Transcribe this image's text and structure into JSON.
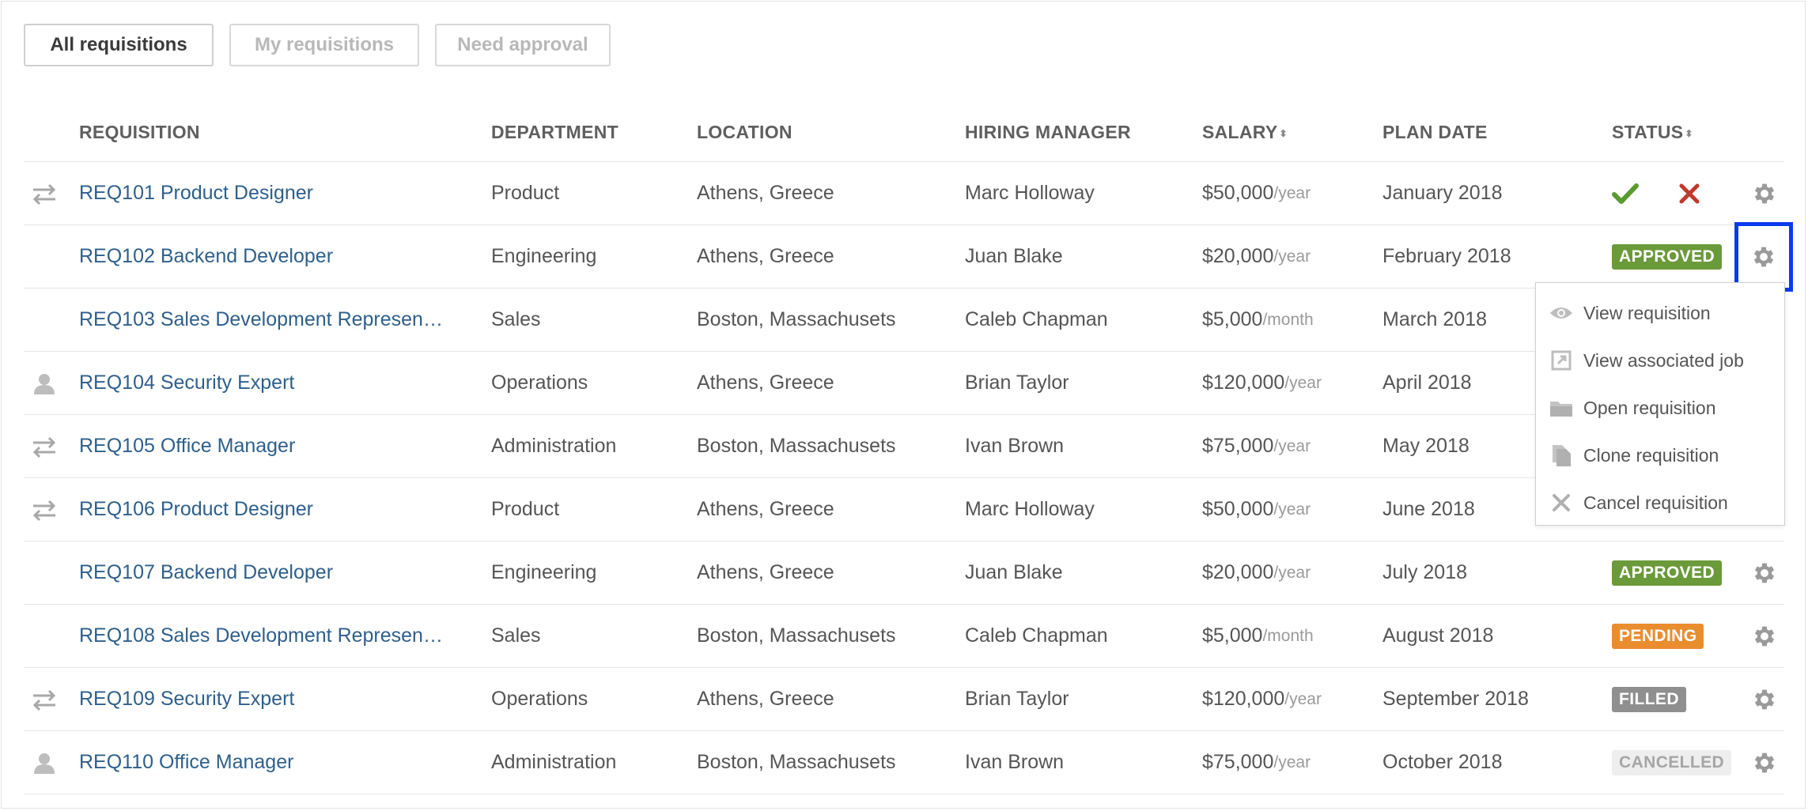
{
  "filters": [
    {
      "label": "All requisitions",
      "active": true
    },
    {
      "label": "My requisitions",
      "active": false
    },
    {
      "label": "Need approval",
      "active": false
    }
  ],
  "columns": {
    "requisition": "REQUISITION",
    "department": "DEPARTMENT",
    "location": "LOCATION",
    "hiring_manager": "HIRING MANAGER",
    "salary": "SALARY",
    "plan_date": "PLAN DATE",
    "status": "STATUS"
  },
  "rows": [
    {
      "icon": "transfer-icon",
      "requisition": "REQ101 Product Designer",
      "department": "Product",
      "location": "Athens, Greece",
      "manager": "Marc Holloway",
      "salary": "$50,000",
      "unit": "/year",
      "plan_date": "January 2018",
      "status": "",
      "actions": true
    },
    {
      "icon": "",
      "requisition": "REQ102 Backend Developer",
      "department": "Engineering",
      "location": "Athens, Greece",
      "manager": "Juan Blake",
      "salary": "$20,000",
      "unit": "/year",
      "plan_date": "February 2018",
      "status": "APPROVED"
    },
    {
      "icon": "",
      "requisition": "REQ103 Sales Development Represen…",
      "department": "Sales",
      "location": "Boston, Massachusets",
      "manager": "Caleb Chapman",
      "salary": "$5,000",
      "unit": "/month",
      "plan_date": "March 2018",
      "status": ""
    },
    {
      "icon": "user-icon",
      "requisition": "REQ104 Security Expert",
      "department": "Operations",
      "location": "Athens, Greece",
      "manager": "Brian Taylor",
      "salary": "$120,000",
      "unit": "/year",
      "plan_date": "April 2018",
      "status": ""
    },
    {
      "icon": "transfer-icon",
      "requisition": "REQ105 Office Manager",
      "department": "Administration",
      "location": "Boston, Massachusets",
      "manager": "Ivan Brown",
      "salary": "$75,000",
      "unit": "/year",
      "plan_date": "May 2018",
      "status": ""
    },
    {
      "icon": "transfer-icon",
      "requisition": "REQ106 Product Designer",
      "department": "Product",
      "location": "Athens, Greece",
      "manager": "Marc Holloway",
      "salary": "$50,000",
      "unit": "/year",
      "plan_date": "June 2018",
      "status": ""
    },
    {
      "icon": "",
      "requisition": "REQ107 Backend Developer",
      "department": "Engineering",
      "location": "Athens, Greece",
      "manager": "Juan Blake",
      "salary": "$20,000",
      "unit": "/year",
      "plan_date": "July 2018",
      "status": "APPROVED"
    },
    {
      "icon": "",
      "requisition": "REQ108 Sales Development Represen…",
      "department": "Sales",
      "location": "Boston, Massachusets",
      "manager": "Caleb Chapman",
      "salary": "$5,000",
      "unit": "/month",
      "plan_date": "August 2018",
      "status": "PENDING"
    },
    {
      "icon": "transfer-icon",
      "requisition": "REQ109 Security Expert",
      "department": "Operations",
      "location": "Athens, Greece",
      "manager": "Brian Taylor",
      "salary": "$120,000",
      "unit": "/year",
      "plan_date": "September 2018",
      "status": "FILLED"
    },
    {
      "icon": "user-icon",
      "requisition": "REQ110 Office Manager",
      "department": "Administration",
      "location": "Boston, Massachusets",
      "manager": "Ivan Brown",
      "salary": "$75,000",
      "unit": "/year",
      "plan_date": "October 2018",
      "status": "CANCELLED"
    }
  ],
  "menu": {
    "items": [
      {
        "icon": "eye-icon",
        "label": "View requisition"
      },
      {
        "icon": "external-link-icon",
        "label": "View associated job"
      },
      {
        "icon": "folder-icon",
        "label": "Open requisition"
      },
      {
        "icon": "copy-icon",
        "label": "Clone requisition"
      },
      {
        "icon": "close-icon",
        "label": "Cancel requisition"
      }
    ]
  },
  "colors": {
    "link": "#2e5f8c",
    "approved": "#6b9a3a",
    "pending": "#ea8d2f",
    "filled": "#8f8f8f",
    "approve_check": "#5a9a2e",
    "reject_x": "#c0392b",
    "highlight": "#0a3af0"
  }
}
